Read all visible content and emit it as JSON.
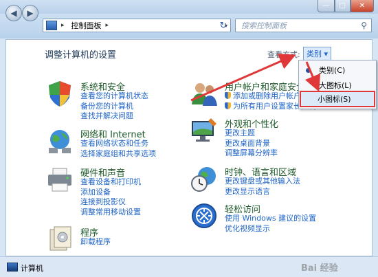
{
  "window": {
    "min_glyph": "—",
    "max_glyph": "□",
    "close_glyph": "✕"
  },
  "nav": {
    "back_glyph": "◀",
    "forward_glyph": "▶"
  },
  "address": {
    "text": "控制面板",
    "chevron": "▸",
    "drop_glyph": "▾",
    "refresh_glyph": "↻"
  },
  "search": {
    "placeholder": "搜索控制面板",
    "glass_glyph": "⚲"
  },
  "main": {
    "heading": "调整计算机的设置",
    "view_by_label": "查看方式:",
    "view_by_value": "类别 ▾"
  },
  "categories": [
    {
      "title": "系统和安全",
      "links": [
        "查看您的计算机状态",
        "备份您的计算机",
        "查找并解决问题"
      ]
    },
    {
      "title": "用户帐户和家庭安全",
      "links": [
        "添加或删除用户帐户",
        "为所有用户设置家长控制"
      ]
    },
    {
      "title": "网络和 Internet",
      "links": [
        "查看网络状态和任务",
        "选择家庭组和共享选项"
      ]
    },
    {
      "title": "外观和个性化",
      "links": [
        "更改主题",
        "更改桌面背景",
        "调整屏幕分辨率"
      ]
    },
    {
      "title": "硬件和声音",
      "links": [
        "查看设备和打印机",
        "添加设备",
        "连接到投影仪",
        "调整常用移动设置"
      ]
    },
    {
      "title": "时钟、语言和区域",
      "links": [
        "更改键盘或其他输入法",
        "更改显示语言"
      ]
    },
    {
      "title": "程序",
      "links": [
        "卸载程序"
      ]
    },
    {
      "title": "轻松访问",
      "links": [
        "使用 Windows 建议的设置",
        "优化视频显示"
      ]
    }
  ],
  "dropdown": {
    "items": [
      "类别(C)",
      "大图标(L)",
      "小图标(S)"
    ],
    "selected": "类别(C)",
    "highlighted": "小图标(S)"
  },
  "status": {
    "text": "计算机"
  },
  "watermark": {
    "text": "Bai 经验"
  },
  "colors": {
    "link": "#1e64c8",
    "category_title": "#1e5a2a",
    "annotation": "#e03838"
  }
}
